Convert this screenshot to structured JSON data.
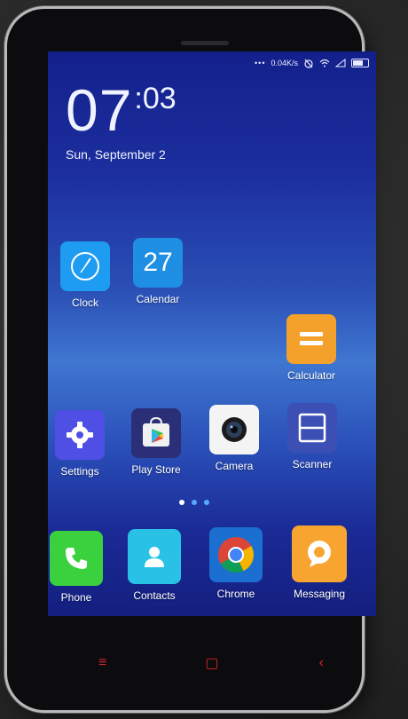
{
  "status_bar": {
    "network_speed": "0.04K/s"
  },
  "clock_widget": {
    "hours": "07",
    "minutes": ":03",
    "date": "Sun, September 2"
  },
  "calendar_icon_day": "27",
  "apps": {
    "clock": "Clock",
    "calendar": "Calendar",
    "calculator": "Calculator",
    "settings": "Settings",
    "play_store": "Play Store",
    "camera": "Camera",
    "scanner": "Scanner"
  },
  "dock": {
    "phone": "Phone",
    "contacts": "Contacts",
    "chrome": "Chrome",
    "messaging": "Messaging"
  },
  "page_indicator": {
    "pages": 3,
    "active_page": 1
  },
  "nav_keys": {
    "menu": "≡",
    "home": "▢",
    "back": "‹"
  },
  "colors": {
    "nav_key": "#d6242d",
    "clock_icon": "#1e9cf2",
    "calendar_icon": "#1e8fe3",
    "calculator_icon": "#f3a12a",
    "settings_icon": "#4f4fe6",
    "scanner_icon": "#3c4fb5",
    "phone_icon": "#3bd13e",
    "contacts_icon": "#29c2e6",
    "messaging_icon": "#f7a530"
  }
}
